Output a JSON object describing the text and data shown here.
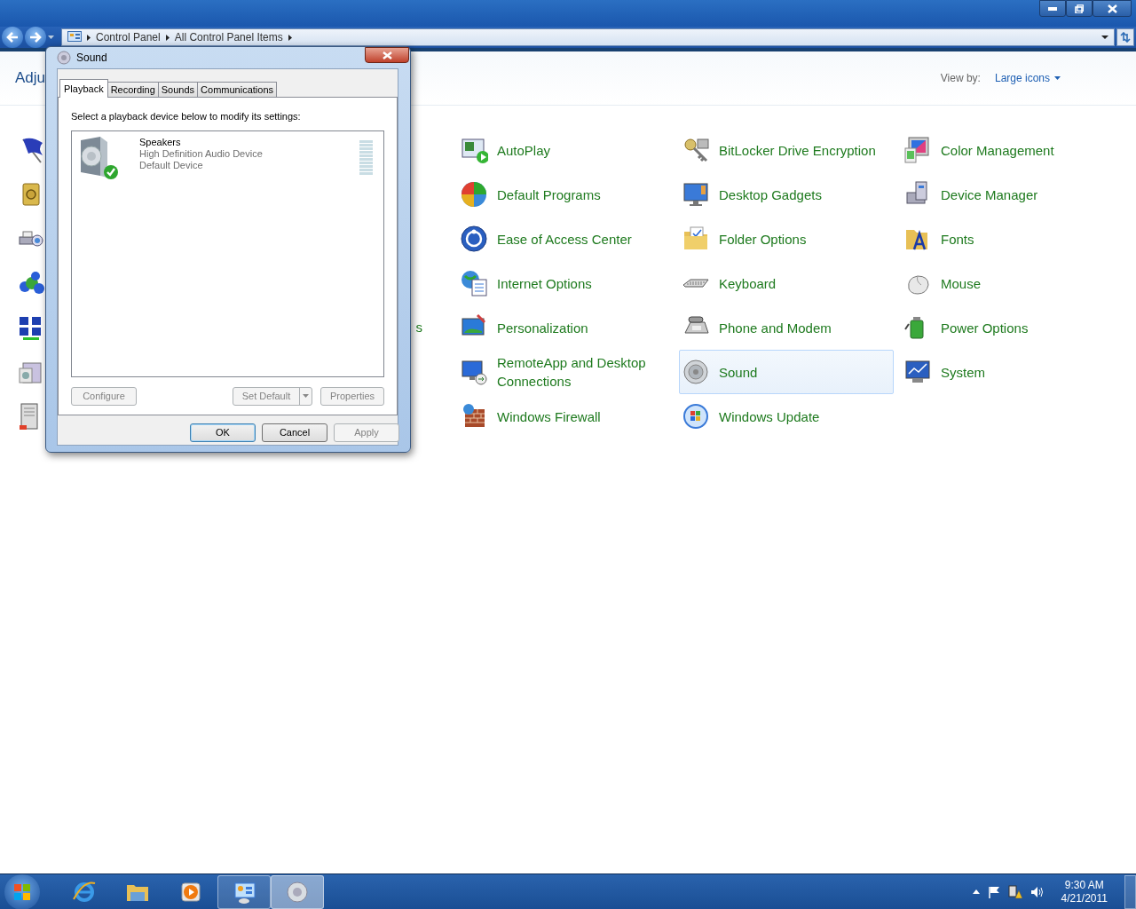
{
  "window": {
    "breadcrumb": [
      "Control Panel",
      "All Control Panel Items"
    ]
  },
  "heading": "Adju",
  "view_by": {
    "label": "View by:",
    "value": "Large icons"
  },
  "rows": [
    [
      {
        "selected": false
      },
      {
        "label": "AutoPlay",
        "selected": false
      },
      {
        "label": "BitLocker Drive Encryption",
        "selected": false
      },
      {
        "label": "Color Management",
        "selected": false
      }
    ],
    [
      {
        "selected": false
      },
      {
        "label": "Default Programs",
        "selected": false
      },
      {
        "label": "Desktop Gadgets",
        "selected": false
      },
      {
        "label": "Device Manager",
        "selected": false
      }
    ],
    [
      {
        "selected": false
      },
      {
        "label": "Ease of Access Center",
        "selected": false
      },
      {
        "label": "Folder Options",
        "selected": false
      },
      {
        "label": "Fonts",
        "selected": false
      }
    ],
    [
      {
        "selected": false
      },
      {
        "label": "Internet Options",
        "selected": false
      },
      {
        "label": "Keyboard",
        "selected": false
      },
      {
        "label": "Mouse",
        "selected": false
      }
    ],
    [
      {
        "label_tail": "s",
        "selected": false
      },
      {
        "label": "Personalization",
        "selected": false
      },
      {
        "label": "Phone and Modem",
        "selected": false
      },
      {
        "label": "Power Options",
        "selected": false
      }
    ],
    [
      {
        "selected": false
      },
      {
        "label": "RemoteApp and Desktop Connections",
        "selected": false
      },
      {
        "label": "Sound",
        "selected": true
      },
      {
        "label": "System",
        "selected": false
      }
    ],
    [
      {
        "selected": false
      },
      {
        "label": "Windows Firewall",
        "selected": false
      },
      {
        "label": "Windows Update",
        "selected": false
      }
    ]
  ],
  "dialog": {
    "title": "Sound",
    "tabs": [
      {
        "label": "Playback",
        "selected": true
      },
      {
        "label": "Recording",
        "selected": false
      },
      {
        "label": "Sounds",
        "selected": false
      },
      {
        "label": "Communications",
        "selected": false
      }
    ],
    "instruction": "Select a playback device below to modify its settings:",
    "devices": [
      {
        "name": "Speakers",
        "description": "High Definition Audio Device",
        "status": "Default Device",
        "default": true,
        "level": 0
      }
    ],
    "device_buttons": [
      {
        "label": "Configure",
        "disabled": true,
        "kind": "plain"
      },
      {
        "label": "Set Default",
        "disabled": true,
        "kind": "split"
      },
      {
        "label": "Properties",
        "disabled": true,
        "kind": "plain"
      }
    ],
    "buttons": [
      {
        "label": "OK",
        "disabled": false,
        "default": true
      },
      {
        "label": "Cancel",
        "disabled": false,
        "default": false
      },
      {
        "label": "Apply",
        "disabled": true,
        "default": false
      }
    ]
  },
  "taskbar": {
    "items": [
      {
        "kind": "browser",
        "open": false,
        "active": false
      },
      {
        "kind": "folder",
        "open": false,
        "active": false
      },
      {
        "kind": "media",
        "open": false,
        "active": false
      },
      {
        "kind": "control-panel",
        "open": true,
        "active": false
      },
      {
        "kind": "speaker",
        "open": true,
        "active": true
      }
    ],
    "clock": {
      "time": "9:30 AM",
      "date": "4/21/2011"
    }
  }
}
